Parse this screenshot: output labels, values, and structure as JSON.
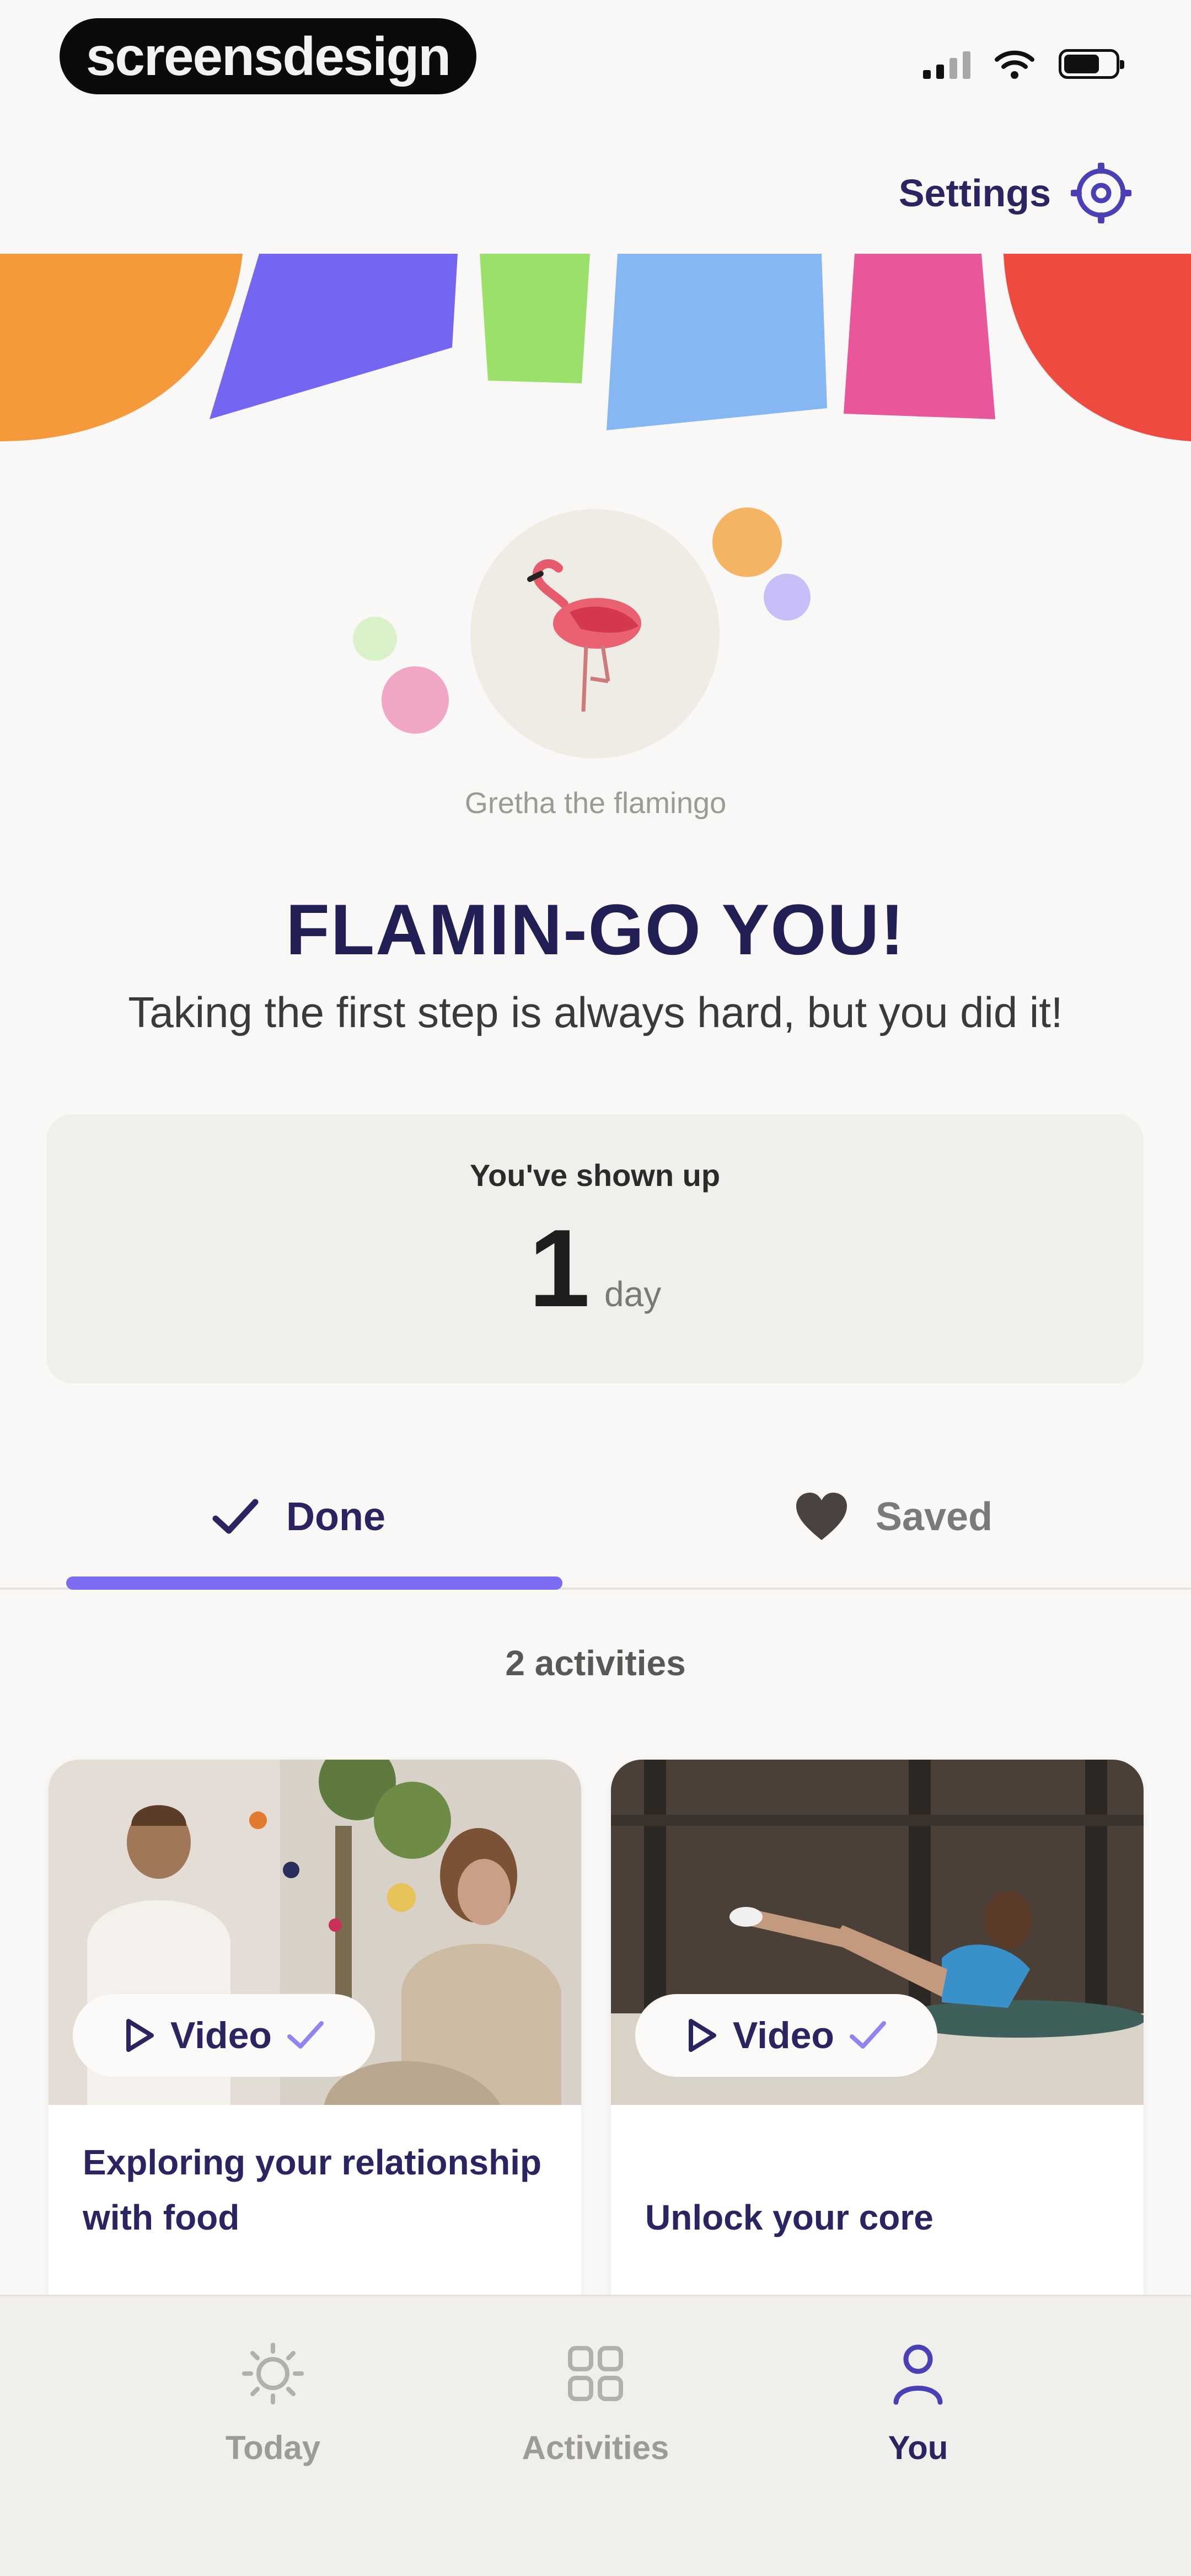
{
  "status_bar": {
    "brand_label": "screensdesign",
    "icons": [
      "cellular-signal-icon",
      "wifi-icon",
      "battery-icon"
    ]
  },
  "header": {
    "settings_label": "Settings",
    "settings_icon": "gear-icon"
  },
  "mascot": {
    "name": "Gretha the flamingo",
    "icon": "flamingo-icon"
  },
  "celebration": {
    "headline": "FLAMIN-GO YOU!",
    "subline": "Taking the first step is always hard, but you did it!"
  },
  "streak": {
    "title": "You've shown up",
    "value": "1",
    "unit": "day"
  },
  "tabs": [
    {
      "label": "Done",
      "icon": "checkmark-icon",
      "active": true
    },
    {
      "label": "Saved",
      "icon": "heart-icon",
      "active": false
    }
  ],
  "activity_count_label": "2 activities",
  "activities": [
    {
      "type_label": "Video",
      "title": "Exploring your relationship with food"
    },
    {
      "type_label": "Video",
      "title": "Unlock your core"
    }
  ],
  "bottom_nav": [
    {
      "label": "Today",
      "icon": "sun-icon",
      "active": false
    },
    {
      "label": "Activities",
      "icon": "grid-icon",
      "active": false
    },
    {
      "label": "You",
      "icon": "person-icon",
      "active": true
    }
  ],
  "colors": {
    "primary_text": "#221f55",
    "accent": "#7c6cf2",
    "background": "#f9f8f6"
  }
}
